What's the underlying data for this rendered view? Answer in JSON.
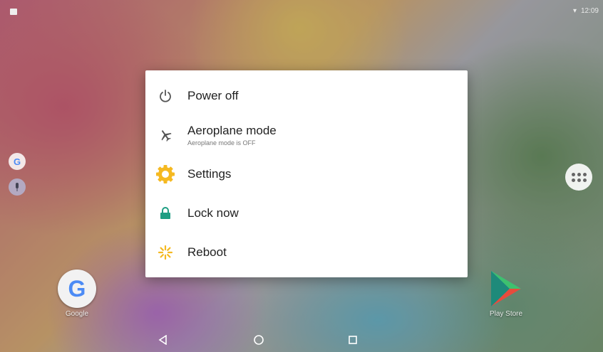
{
  "status_bar": {
    "time": "12:09"
  },
  "power_menu": {
    "items": [
      {
        "label": "Power off",
        "icon": "power-icon"
      },
      {
        "label": "Aeroplane mode",
        "sublabel": "Aeroplane mode is OFF",
        "icon": "airplane-icon"
      },
      {
        "label": "Settings",
        "icon": "gear-icon",
        "icon_color": "#F5B921"
      },
      {
        "label": "Lock now",
        "icon": "lock-icon",
        "icon_color": "#1E9E83"
      },
      {
        "label": "Reboot",
        "icon": "reboot-icon",
        "icon_color": "#F5B921"
      }
    ]
  },
  "home_screen": {
    "apps": [
      {
        "label": "Google",
        "icon": "google-icon"
      },
      {
        "label": "Play Store",
        "icon": "play-store-icon"
      }
    ],
    "side_dock": [
      {
        "icon": "google-search-icon"
      },
      {
        "icon": "microphone-icon"
      }
    ]
  },
  "navigation_bar": {
    "buttons": [
      "back",
      "home",
      "recents"
    ]
  }
}
